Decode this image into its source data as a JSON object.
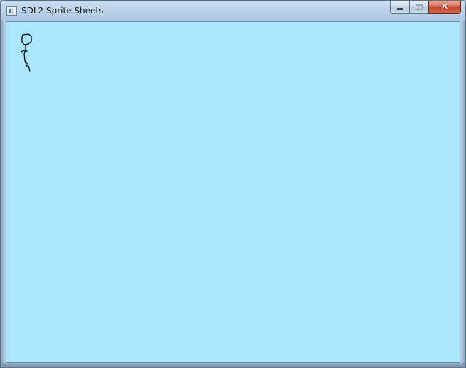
{
  "window": {
    "title": "SDL2 Sprite Sheets",
    "icon": "app-window-icon",
    "caption_buttons": {
      "minimize": {
        "icon": "minimize-icon",
        "label": ""
      },
      "maximize": {
        "icon": "maximize-icon",
        "label": "",
        "enabled": false
      },
      "close": {
        "icon": "close-icon",
        "label": "✕"
      }
    }
  },
  "client": {
    "background_color": "#aae6ff",
    "sprite": {
      "name": "stick-figure-sprite",
      "stroke_color": "#000000"
    }
  },
  "colors": {
    "close_button": "#c24b33",
    "frame": "#a9c4df"
  }
}
